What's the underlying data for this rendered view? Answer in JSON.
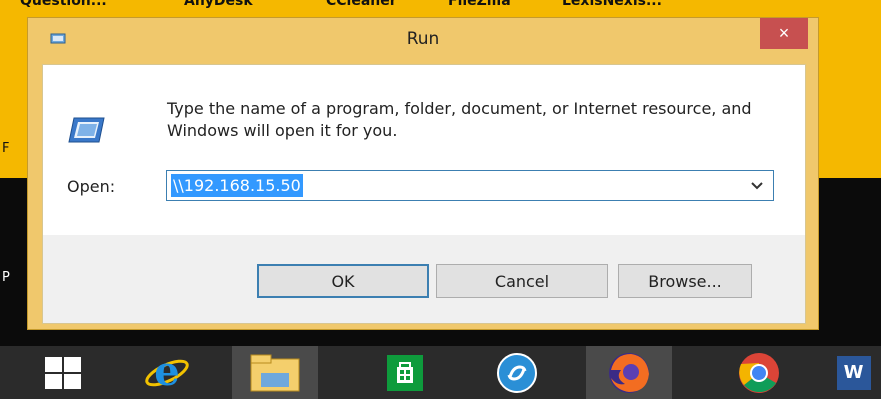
{
  "desktop": {
    "shortcut_labels": [
      "Question...",
      "AnyDesk",
      "CCleaner",
      "FileZilla",
      "LexisNexis..."
    ],
    "edge_letters": [
      "F",
      "P"
    ]
  },
  "dialog": {
    "title": "Run",
    "close_symbol": "×",
    "description": "Type the name of a program, folder, document, or Internet resource, and Windows will open it for you.",
    "open_label": "Open:",
    "open_value": "\\\\192.168.15.50",
    "buttons": {
      "ok": "OK",
      "cancel": "Cancel",
      "browse": "Browse..."
    }
  },
  "taskbar": {
    "items": [
      {
        "icon": "windows-start-icon"
      },
      {
        "icon": "internet-explorer-icon"
      },
      {
        "icon": "file-explorer-icon"
      },
      {
        "icon": "store-icon"
      },
      {
        "icon": "app-icon"
      },
      {
        "icon": "firefox-icon"
      },
      {
        "icon": "chrome-icon"
      },
      {
        "icon": "word-icon",
        "label": "W"
      }
    ]
  },
  "colors": {
    "desktop": "#f5b800",
    "dialog_frame": "#f0c86c",
    "close_button": "#c75050",
    "selection": "#3399ff",
    "taskbar": "#2b2b2b"
  }
}
